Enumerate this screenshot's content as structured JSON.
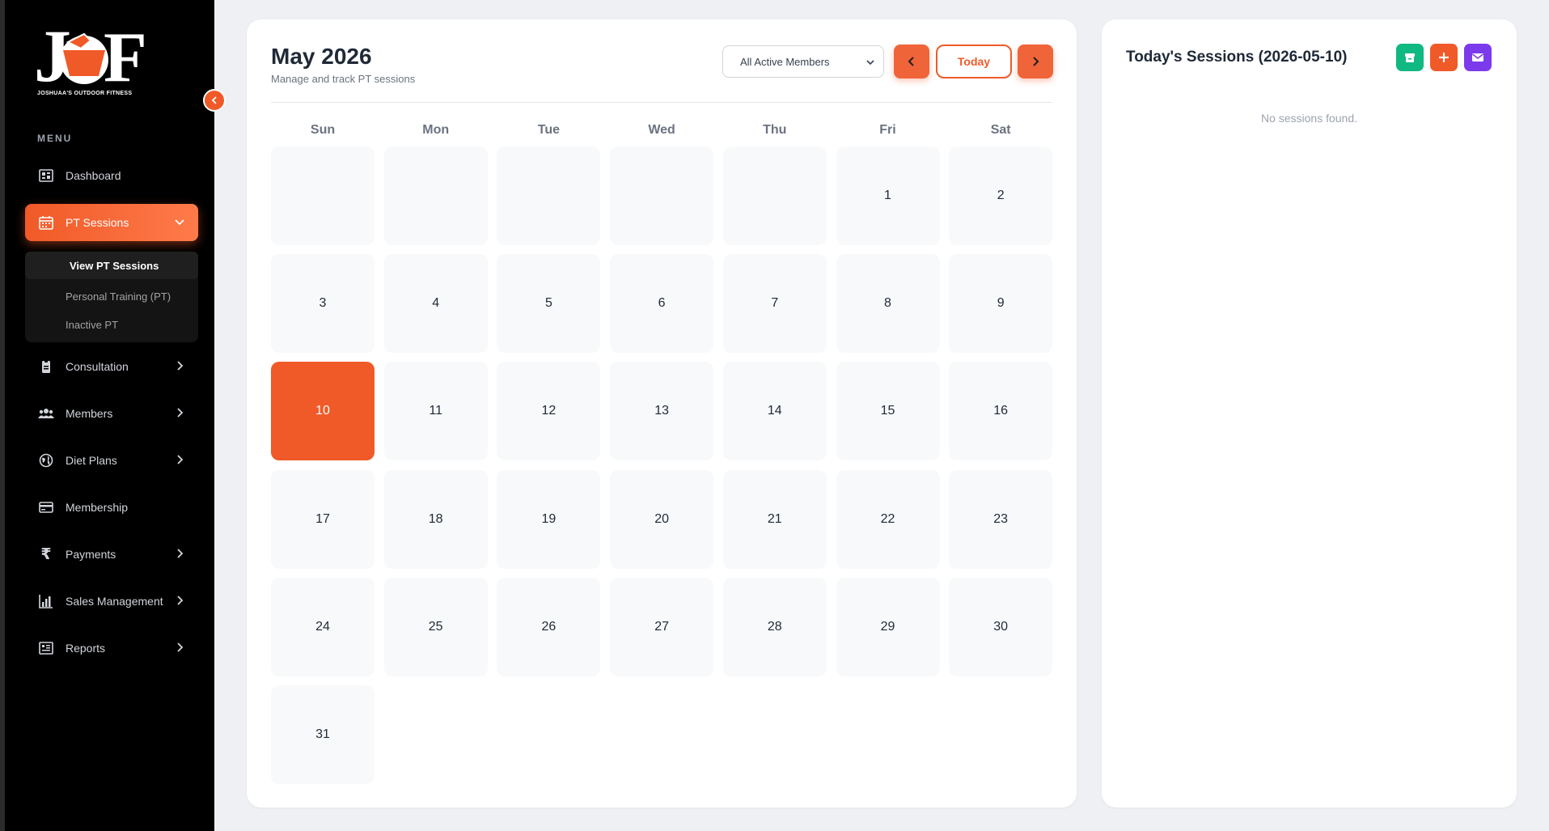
{
  "brand": {
    "tagline": "JOSHUAA'S OUTDOOR FITNESS"
  },
  "sidebar": {
    "menu_label": "MENU",
    "items": [
      {
        "label": "Dashboard",
        "icon": "dashboard-icon"
      },
      {
        "label": "PT Sessions",
        "icon": "calendar-icon",
        "active": true,
        "expanded": true
      },
      {
        "label": "Consultation",
        "icon": "clipboard-icon"
      },
      {
        "label": "Members",
        "icon": "users-icon"
      },
      {
        "label": "Diet Plans",
        "icon": "globe-icon"
      },
      {
        "label": "Membership",
        "icon": "card-icon"
      },
      {
        "label": "Payments",
        "icon": "rupee-icon"
      },
      {
        "label": "Sales Management",
        "icon": "bar-chart-icon"
      },
      {
        "label": "Reports",
        "icon": "report-icon"
      }
    ],
    "submenu": [
      {
        "label": "View PT Sessions",
        "active": true
      },
      {
        "label": "Personal Training (PT)"
      },
      {
        "label": "Inactive PT"
      }
    ]
  },
  "calendar": {
    "title": "May 2026",
    "subtitle": "Manage and track PT sessions",
    "member_filter": "All Active Members",
    "today_label": "Today",
    "weekdays": [
      "Sun",
      "Mon",
      "Tue",
      "Wed",
      "Thu",
      "Fri",
      "Sat"
    ],
    "first_weekday_index": 5,
    "days_in_month": 31,
    "selected_day": 10
  },
  "sessions": {
    "title": "Today's Sessions (2026-05-10)",
    "empty_message": "No sessions found.",
    "colors": {
      "export": "#10b981",
      "add": "#f05a28",
      "email": "#7c3aed"
    }
  },
  "colors": {
    "accent": "#f05a28"
  }
}
